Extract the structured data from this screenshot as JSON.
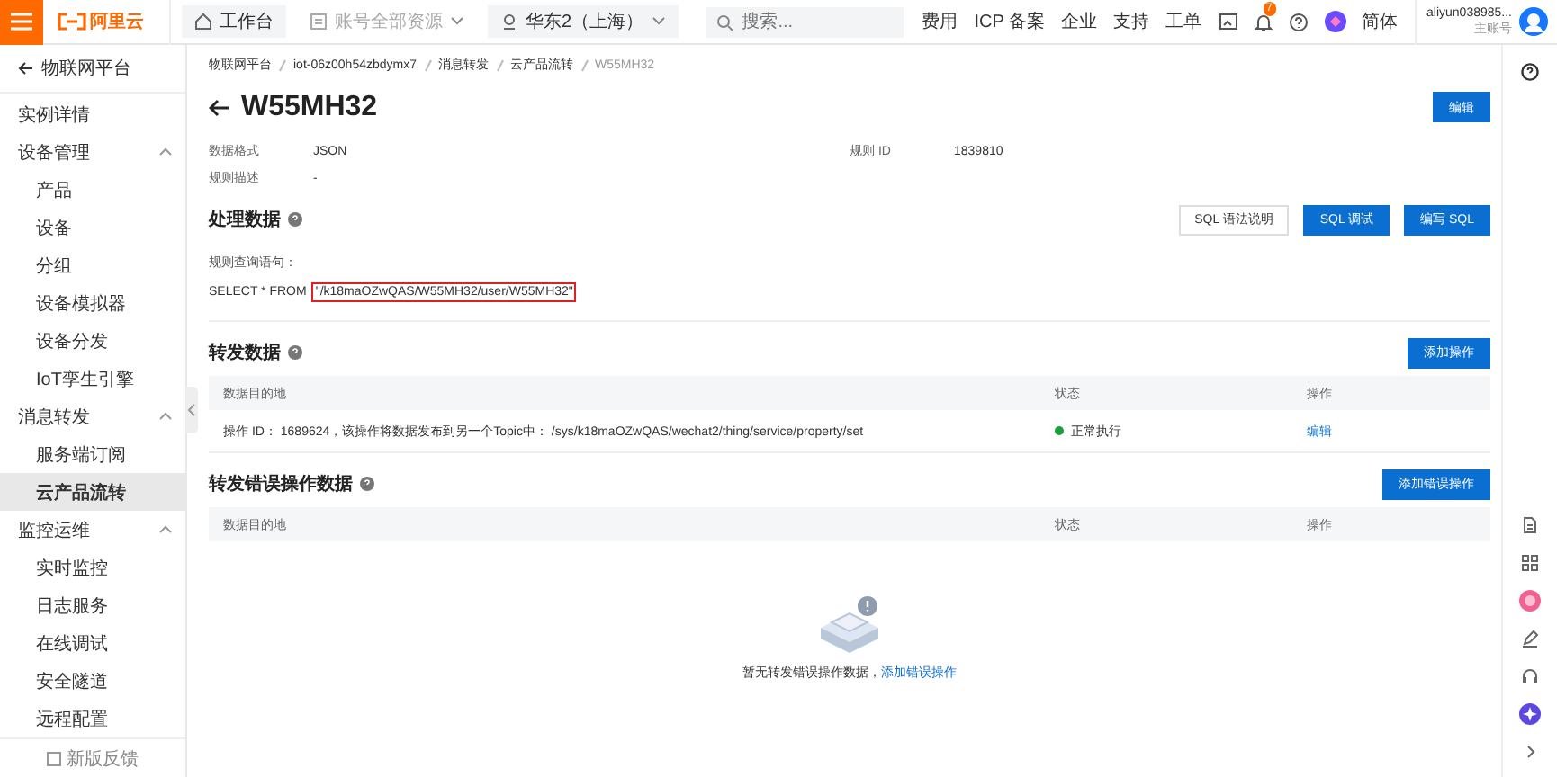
{
  "topbar": {
    "brand": "阿里云",
    "nav": [
      {
        "kind": "home",
        "label": "工作台",
        "disabled": false
      },
      {
        "kind": "resource",
        "label": "账号全部资源",
        "disabled": true
      },
      {
        "kind": "region",
        "label": "华东2（上海）",
        "disabled": false
      }
    ],
    "search": {
      "placeholder": "搜索..."
    },
    "links": [
      "费用",
      "ICP 备案",
      "企业",
      "支持",
      "工单"
    ],
    "notification_badge": "7",
    "language": "简体",
    "user": {
      "name": "aliyun038985...",
      "role": "主账号"
    }
  },
  "sidebar": {
    "back": "物联网平台",
    "items": [
      {
        "label": "实例详情",
        "selected": false
      },
      {
        "label": "设备管理",
        "expanded": true,
        "children": [
          {
            "label": "产品",
            "selected": false
          },
          {
            "label": "设备",
            "selected": false
          },
          {
            "label": "分组",
            "selected": false
          },
          {
            "label": "设备模拟器",
            "selected": false
          },
          {
            "label": "设备分发",
            "selected": false
          },
          {
            "label": "IoT孪生引擎",
            "selected": false
          }
        ]
      },
      {
        "label": "消息转发",
        "expanded": true,
        "children": [
          {
            "label": "服务端订阅",
            "selected": false
          },
          {
            "label": "云产品流转",
            "selected": true
          }
        ]
      },
      {
        "label": "监控运维",
        "expanded": true,
        "children": [
          {
            "label": "实时监控",
            "selected": false
          },
          {
            "label": "日志服务",
            "selected": false
          },
          {
            "label": "在线调试",
            "selected": false
          },
          {
            "label": "安全隧道",
            "selected": false
          },
          {
            "label": "远程配置",
            "selected": false
          }
        ]
      }
    ],
    "feedback": "新版反馈"
  },
  "breadcrumb": [
    "物联网平台",
    "iot-06z00h54zbdymx7",
    "消息转发",
    "云产品流转",
    "W55MH32"
  ],
  "title": "W55MH32",
  "edit_button": "编辑",
  "fields": [
    {
      "label": "数据格式",
      "value": "JSON"
    },
    {
      "label": "规则 ID",
      "value": "1839810"
    },
    {
      "label": "规则描述",
      "value": "-"
    }
  ],
  "process": {
    "heading": "处理数据",
    "buttons": [
      {
        "label": "SQL 语法说明",
        "primary": false
      },
      {
        "label": "SQL 调试",
        "primary": true
      },
      {
        "label": "编写 SQL",
        "primary": true
      }
    ],
    "query_label": "规则查询语句：",
    "query_prefix": "SELECT * FROM",
    "query_topic": "\"/k18maOZwQAS/W55MH32/user/W55MH32\""
  },
  "forward": {
    "heading": "转发数据",
    "button": "添加操作",
    "columns": [
      "数据目的地",
      "状态",
      "操作"
    ],
    "rows": [
      {
        "destination": "操作 ID： 1689624，该操作将数据发布到另一个Topic中： /sys/k18maOZwQAS/wechat2/thing/service/property/set",
        "status": "正常执行",
        "color": "#1e9e3a",
        "action": "编辑"
      }
    ]
  },
  "errors": {
    "heading": "转发错误操作数据",
    "button": "添加错误操作",
    "columns": [
      "数据目的地",
      "状态",
      "操作"
    ],
    "empty_text": "暂无转发错误操作数据，",
    "empty_link": "添加错误操作"
  }
}
